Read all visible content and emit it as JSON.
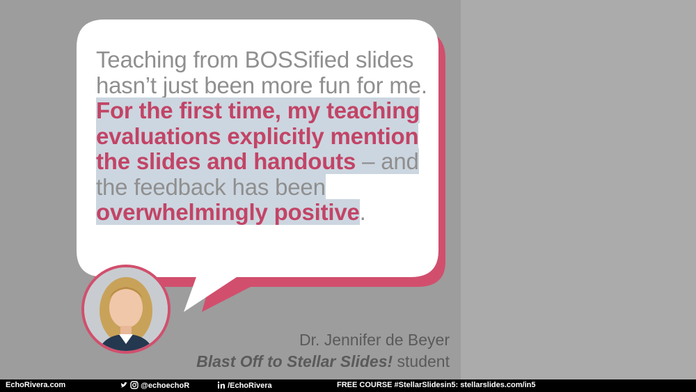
{
  "quote": {
    "intro": "Teaching from BOSSified slides hasn’t just been more fun for me. ",
    "emphasis_1": "For the first time, my teaching evaluations explicitly mention the slides and handouts",
    "middle": " – and the feedback has been ",
    "emphasis_2": "overwhelmingly positive",
    "end": "."
  },
  "attribution": {
    "name": "Dr. Jennifer de Beyer",
    "course": "Blast Off to Stellar Slides!",
    "role": " student"
  },
  "footer": {
    "site": "EchoRivera.com",
    "social_handle": "@echoechoR",
    "linkedin": "/EchoRivera",
    "course_promo": "FREE COURSE #StellarSlidesin5: stellarslides.com/in5"
  },
  "colors": {
    "background": "#9d9d9d",
    "accent": "#c24466",
    "bubble_shadow": "#d14f6d",
    "highlight": "#ccd6e0"
  },
  "icons": [
    "twitter-icon",
    "instagram-icon",
    "linkedin-icon"
  ]
}
